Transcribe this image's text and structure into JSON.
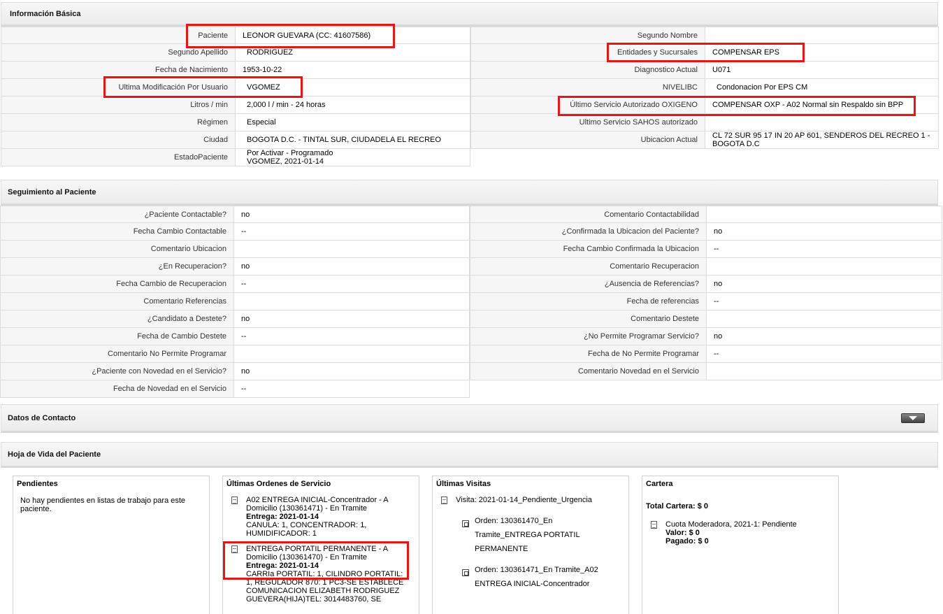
{
  "basic": {
    "title": "Información Básica",
    "left": [
      {
        "label": "Paciente",
        "value": "LEONOR GUEVARA (CC: 41607586)"
      },
      {
        "label": "Segundo Apellido",
        "value": "RODRIGUEZ"
      },
      {
        "label": "Fecha de Nacimiento",
        "value": "1953-10-22"
      },
      {
        "label": "Ultima Modificación Por Usuario",
        "value": "VGOMEZ"
      },
      {
        "label": "Litros / min",
        "value": "2,000 l / min - 24 horas"
      },
      {
        "label": "Régimen",
        "value": "Especial"
      },
      {
        "label": "Ciudad",
        "value": "BOGOTA D.C. - TINTAL SUR, CIUDADELA EL RECREO"
      },
      {
        "label": "EstadoPaciente",
        "value": "Por Activar - Programado",
        "value2": "VGOMEZ, 2021-01-14"
      }
    ],
    "right": [
      {
        "label": "Segundo Nombre",
        "value": ""
      },
      {
        "label": "Entidades y Sucursales",
        "value": "COMPENSAR EPS"
      },
      {
        "label": "Diagnostico Actual",
        "value": "U071"
      },
      {
        "label": "NIVELIBC",
        "value": "Condonacion Por EPS CM"
      },
      {
        "label": "Último Servicio Autorizado OXIGENO",
        "value": "COMPENSAR OXP - A02 Normal sin Respaldo sin BPP"
      },
      {
        "label": "Ultimo Servicio SAHOS autorizado",
        "value": ""
      },
      {
        "label": "Ubicacion Actual",
        "value": "CL 72 SUR 95 17 IN 20 AP 601, SENDEROS DEL RECREO 1 -",
        "value2": "BOGOTA D.C"
      }
    ]
  },
  "followup": {
    "title": "Seguimiento al Paciente",
    "left": [
      {
        "label": "¿Paciente Contactable?",
        "value": "no"
      },
      {
        "label": "Fecha Cambio Contactable",
        "value": "--"
      },
      {
        "label": "Comentario Ubicacion",
        "value": ""
      },
      {
        "label": "¿En Recuperacion?",
        "value": "no"
      },
      {
        "label": "Fecha Cambio de Recuperacion",
        "value": "--"
      },
      {
        "label": "Comentario Referencias",
        "value": ""
      },
      {
        "label": "¿Candidato a Destete?",
        "value": "no"
      },
      {
        "label": "Fecha de Cambio Destete",
        "value": "--"
      },
      {
        "label": "Comentario No Permite Programar",
        "value": ""
      },
      {
        "label": "¿Paciente con Novedad en el Servicio?",
        "value": "no"
      },
      {
        "label": "Fecha de Novedad en el Servicio",
        "value": "--"
      }
    ],
    "right": [
      {
        "label": "Comentario Contactabilidad",
        "value": ""
      },
      {
        "label": "¿Confirmada la Ubicacion del Paciente?",
        "value": "no"
      },
      {
        "label": "Fecha Cambio Confirmada la Ubicacion",
        "value": "--"
      },
      {
        "label": "Comentario Recuperacion",
        "value": ""
      },
      {
        "label": "¿Ausencia de Referencias?",
        "value": "no"
      },
      {
        "label": "Fecha de referencias",
        "value": "--"
      },
      {
        "label": "Comentario Destete",
        "value": ""
      },
      {
        "label": "¿No Permite Programar Servicio?",
        "value": "no"
      },
      {
        "label": "Fecha de No Permite Programar",
        "value": "--"
      },
      {
        "label": "Comentario Novedad en el Servicio",
        "value": ""
      }
    ]
  },
  "contact": {
    "title": "Datos de Contacto"
  },
  "history": {
    "title": "Hoja de Vida del Paciente",
    "pending": {
      "title": "Pendientes",
      "text": "No hay pendientes en listas de trabajo para este paciente."
    },
    "orders": {
      "title": "Últimas Ordenes de Servicio",
      "items": [
        {
          "head": "A02 ENTREGA INICIAL-Concentrador - A Domicilio (130361471) - En Tramite",
          "delivery": "Entrega: 2021-01-14",
          "detail": "CANULA: 1, CONCENTRADOR: 1, HUMIDIFICADOR: 1"
        },
        {
          "head": "ENTREGA PORTATIL PERMANENTE - A Domicilio (130361470) - En Tramite",
          "delivery": "Entrega: 2021-01-14",
          "detail": "CARRIa PORTATIL: 1, CILINDRO PORTATIL: 1, REGULADOR 870: 1 PC3-SE ESTABLECE COMUNICACION ELIZABETH RODRIGUEZ GUEVERA(HIJA)TEL: 3014483760, SE"
        }
      ]
    },
    "visits": {
      "title": "Últimas Visitas",
      "visit": "Visita: 2021-01-14_Pendiente_Urgencia",
      "orders": [
        "Orden: 130361470_En Tramite_ENTREGA PORTATIL PERMANENTE",
        "Orden: 130361471_En Tramite_A02 ENTREGA INICIAL-Concentrador"
      ]
    },
    "portfolio": {
      "title": "Cartera",
      "total": "Total Cartera: $ 0",
      "fee": "Cuota Moderadora, 2021-1: Pendiente",
      "value": "Valor: $ 0",
      "paid": "Pagado: $ 0"
    }
  },
  "colors": {
    "highlight": "#e01818",
    "header_bg": "#efefef",
    "label_bg": "#f6f6f6"
  }
}
